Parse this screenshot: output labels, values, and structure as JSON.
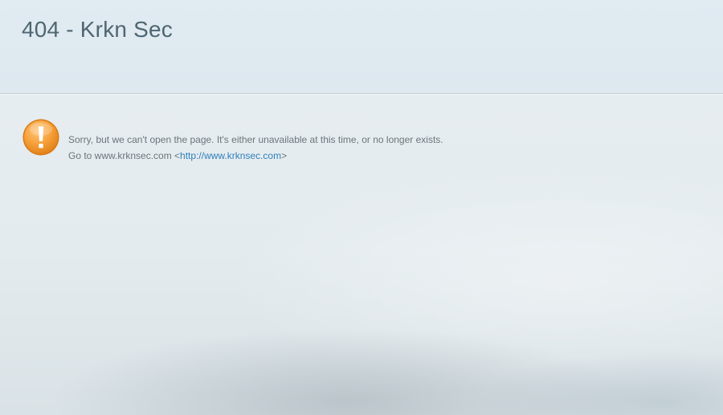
{
  "header": {
    "title": "404 - Krkn Sec"
  },
  "alert": {
    "icon": "exclamation-icon",
    "color": "#f39a2b"
  },
  "message": {
    "line1": "Sorry, but we can't open the page. It's either unavailable at this time, or no longer exists.",
    "line2_prefix": "Go to www.krknsec.com <",
    "link_text": "http://www.krknsec.com",
    "line2_suffix": ">"
  }
}
